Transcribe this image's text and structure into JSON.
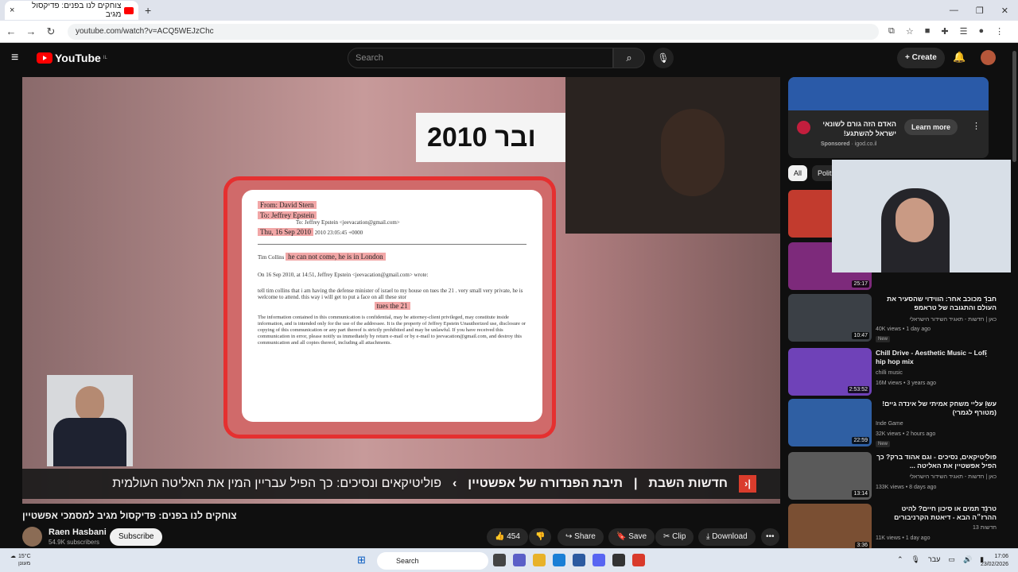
{
  "browser": {
    "tab_title": "צוחקים לנו בפנים: פדיקסול מגיב",
    "tab_close": "×",
    "new_tab": "+",
    "url": "youtube.com/watch?v=ACQ5WEJzChc"
  },
  "youtube": {
    "logo_text": "YouTube",
    "logo_region": "IL",
    "search_placeholder": "Search",
    "create_label": "Create"
  },
  "video": {
    "year_overlay": "2010 ובר",
    "email": {
      "from": "From: David Stern",
      "to": "To: Jeffrey Epstein",
      "cc": "To: Jeffrey Epstein <jeevacation@gmail.com>",
      "date": "Thu, 16 Sep 2010",
      "time": "2010 23:05:45 +0000",
      "line1": "Tim Collins",
      "highlight1": "he can not come, he is in London",
      "quote": "On 16 Sep 2010, at 14:51, Jeffrey Epstein <jeevacation@gmail.com> wrote:",
      "body": "tell tim collins that i am having the defense minister of israel to my house on tues the 21 . very small very private, he is welcome to attend. this way i will get to put a face on all these stor",
      "highlight2": "tues the 21",
      "footer": "The information contained in this communication is confidential, may be attorney-client privileged, may constitute inside information, and is intended only for the use of the addressee. It is the property of Jeffrey Epstein Unauthorized use, disclosure or copying of this communication or any part thereof is strictly prohibited and may be unlawful. If you have received this communication in error, please notify us immediately by return e-mail or by e-mail to jeevacation@gmail.com, and destroy this communication and all copies thereof, including all attachments."
    },
    "ticker": {
      "channel": "חדשות השבת",
      "segment": "תיבת הפנדורה של אפשטיין",
      "headline": "פוליטיקאים ונסיכים: כך הפיל עבריין המין את האליטה העולמית",
      "return_icon": "|‹"
    }
  },
  "meta": {
    "title": "צוחקים לנו בפנים: פדיקסול מגיב למסמכי אפשטיין",
    "channel": "Raen Hasbani",
    "subscribers": "54.9K subscribers",
    "subscribe": "Subscribe",
    "likes": "454",
    "share": "Share",
    "save": "Save",
    "clip": "Clip",
    "download": "Download"
  },
  "ad": {
    "title": "האדם הזה גורם לשונאי ישראל להשתגע!",
    "sponsored": "Sponsored",
    "domain": "igod.co.il",
    "cta": "Learn more"
  },
  "chips": [
    "All",
    "Polit"
  ],
  "recommendations": [
    {
      "title": "",
      "channel": "",
      "stats": "",
      "duration": "",
      "badge": ""
    },
    {
      "title": "",
      "channel": "",
      "stats": "",
      "duration": "25:17",
      "badge": ""
    },
    {
      "title": "חבר מכוכב אחר: הווידוי שהסעיר את העולם והתגובה של טראמפ",
      "channel": "כאן | חדשות - תאגיד השידור הישראלי",
      "stats": "40K views • 1 day ago",
      "duration": "10:47",
      "badge": "New"
    },
    {
      "title": "Chill Drive - Aesthetic Music ~ Lofi hip hop mix",
      "channel": "chilli music",
      "stats": "16M views • 3 years ago",
      "duration": "2:53:52",
      "badge": ""
    },
    {
      "title": "עשו עליי משחק אמיתי של אינדה גיים! (מטורף לגמרי)",
      "channel": "Inde Game",
      "stats": "32K views • 2 hours ago",
      "duration": "22:59",
      "badge": "New"
    },
    {
      "title": "פוליטיקאים, נסיכים - וגם אהוד ברק? כך הפיל אפשטיין את האליטה ...",
      "channel": "כאן | חדשות - תאגיד השידור הישראלי",
      "stats": "133K views • 8 days ago",
      "duration": "13:14",
      "badge": ""
    },
    {
      "title": "טרנד תמים או סיכון חיים? להיט ההרז״ה הבא - דיאטת הקרניבורים",
      "channel": "חדשות 13",
      "stats": "11K views • 1 day ago",
      "duration": "3:36",
      "badge": ""
    }
  ],
  "taskbar": {
    "temp": "15°C",
    "weather": "מעונן",
    "search": "Search",
    "lang": "עבר",
    "time": "17:06",
    "date": "23/02/2026"
  },
  "colors": {
    "yt_red": "#ff0000",
    "bg": "#0f0f0f",
    "ticker_red": "#e23a28"
  }
}
